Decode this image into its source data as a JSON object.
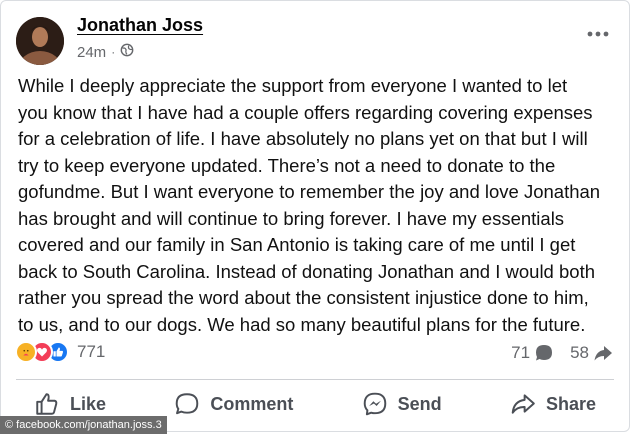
{
  "post": {
    "author": "Jonathan Joss",
    "time": "24m",
    "separator": "·",
    "privacy_icon": "globe-icon",
    "text": "While I deeply appreciate the support from everyone I wanted to let\nyou know that I have had a couple offers regarding covering expenses\nfor a celebration of life. I have absolutely no plans yet on that but I will\ntry to keep everyone updated. There’s not a need to donate to the\ngofundme. But I want everyone to remember the joy and love Jonathan\nhas brought and will continue to bring forever. I have my essentials\ncovered and our family in San Antonio is taking care of me until I get\nback to South Carolina. Instead of donating Jonathan and I would both\nrather you spread the word about the consistent injustice done to him,\nto us, and to our dogs. We had so many beautiful plans for the future."
  },
  "stats": {
    "reactions_count": "771",
    "reaction_icons": [
      "care-icon",
      "love-icon",
      "like-icon"
    ],
    "comments_count": "71",
    "shares_count": "58"
  },
  "actions": {
    "like": "Like",
    "comment": "Comment",
    "send": "Send",
    "share": "Share"
  },
  "watermark": "© facebook.com/jonathan.joss.3",
  "colors": {
    "like_blue": "#1877f2",
    "love_red": "#f33e58",
    "care_yellow": "#f7b125",
    "secondary_text": "#65676b"
  }
}
